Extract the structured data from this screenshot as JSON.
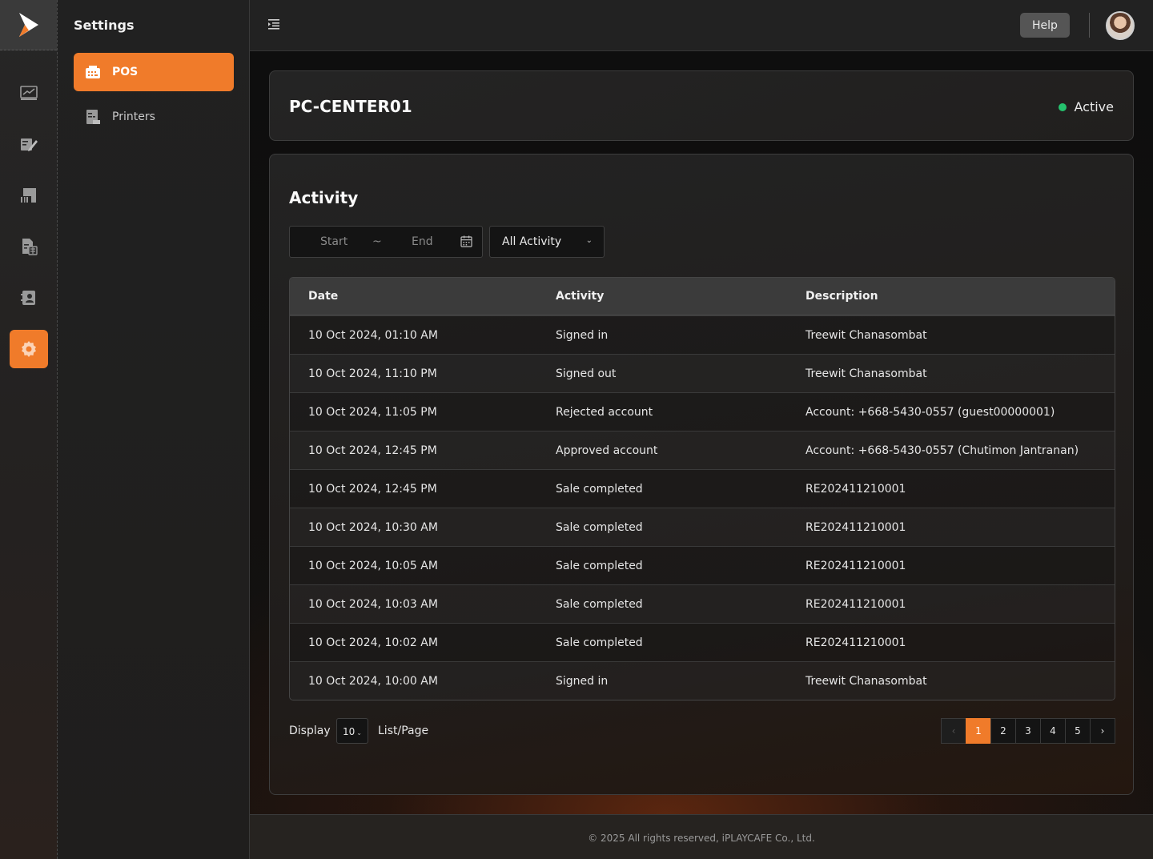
{
  "rail": {
    "items": [
      {
        "icon": "chart-line-icon",
        "active": false
      },
      {
        "icon": "edit-list-icon",
        "active": false
      },
      {
        "icon": "barcode-machine-icon",
        "active": false
      },
      {
        "icon": "report-document-icon",
        "active": false
      },
      {
        "icon": "contact-card-icon",
        "active": false
      },
      {
        "icon": "settings-gear-icon",
        "active": true
      }
    ]
  },
  "sidebar": {
    "title": "Settings",
    "items": [
      {
        "label": "POS",
        "icon": "pos-register-icon",
        "active": true
      },
      {
        "label": "Printers",
        "icon": "printer-icon",
        "active": false
      }
    ]
  },
  "topbar": {
    "help_label": "Help"
  },
  "device": {
    "name": "PC-CENTER01",
    "status": "Active",
    "status_color": "#25c26e"
  },
  "activity": {
    "title": "Activity",
    "date_start_placeholder": "Start",
    "date_separator": "~",
    "date_end_placeholder": "End",
    "filter_value": "All Activity",
    "columns": [
      "Date",
      "Activity",
      "Description"
    ],
    "rows": [
      [
        "10 Oct 2024, 01:10 AM",
        "Signed in",
        "Treewit Chanasombat"
      ],
      [
        "10 Oct 2024, 11:10 PM",
        "Signed out",
        "Treewit Chanasombat"
      ],
      [
        "10 Oct 2024, 11:05 PM",
        "Rejected account",
        "Account: +668-5430-0557 (guest00000001)"
      ],
      [
        "10 Oct 2024, 12:45 PM",
        "Approved account",
        "Account: +668-5430-0557 (Chutimon Jantranan)"
      ],
      [
        "10 Oct 2024, 12:45 PM",
        "Sale completed",
        "RE202411210001"
      ],
      [
        "10 Oct 2024, 10:30 AM",
        "Sale completed",
        "RE202411210001"
      ],
      [
        "10 Oct 2024, 10:05 AM",
        "Sale completed",
        "RE202411210001"
      ],
      [
        "10 Oct 2024, 10:03 AM",
        "Sale completed",
        "RE202411210001"
      ],
      [
        "10 Oct 2024, 10:02 AM",
        "Sale completed",
        "RE202411210001"
      ],
      [
        "10 Oct 2024, 10:00 AM",
        "Signed in",
        "Treewit Chanasombat"
      ]
    ],
    "display_label": "Display",
    "per_page": "10",
    "per_page_suffix": "List/Page",
    "pages": [
      "1",
      "2",
      "3",
      "4",
      "5"
    ],
    "current_page": "1"
  },
  "footer": {
    "copyright": "© 2025 All rights reserved, iPLAYCAFE Co., Ltd."
  },
  "colors": {
    "accent": "#f07b2a"
  }
}
